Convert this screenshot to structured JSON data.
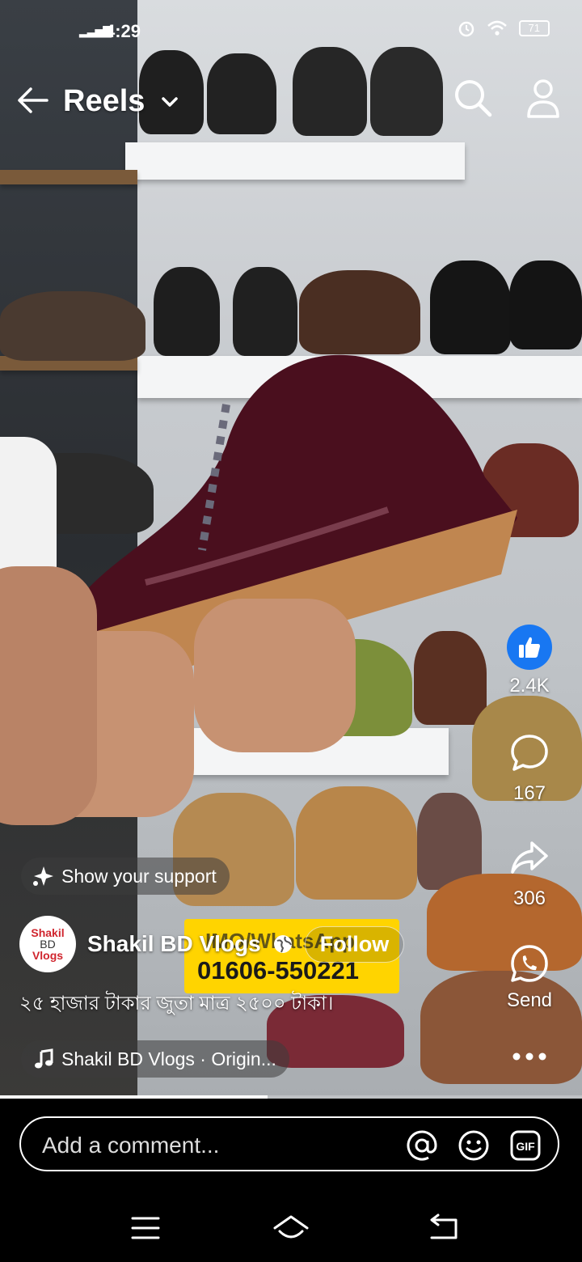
{
  "status_bar": {
    "time": "4:29",
    "battery": "71"
  },
  "header": {
    "title": "Reels"
  },
  "actions": {
    "likes": "2.4K",
    "comments": "167",
    "shares": "306",
    "send_label": "Send"
  },
  "support": {
    "label": "Show your support"
  },
  "author": {
    "name": "Shakil BD Vlogs",
    "follow_label": "Follow",
    "avatar_line1": "Shakil",
    "avatar_line2": "BD",
    "avatar_line3": "Vlogs"
  },
  "caption": "২৫ হাজার টাকার জুতা মাত্র ২৫০০ টাকা।",
  "audio": {
    "label": "Shakil BD Vlogs · Origin..."
  },
  "video_banner": {
    "line1": "IMO/WhatsApp",
    "line2": "01606-550221"
  },
  "progress": 0.46,
  "comment": {
    "placeholder": "Add a comment..."
  },
  "colors": {
    "like_blue": "#1877f2",
    "banner_yellow": "#ffd400"
  }
}
